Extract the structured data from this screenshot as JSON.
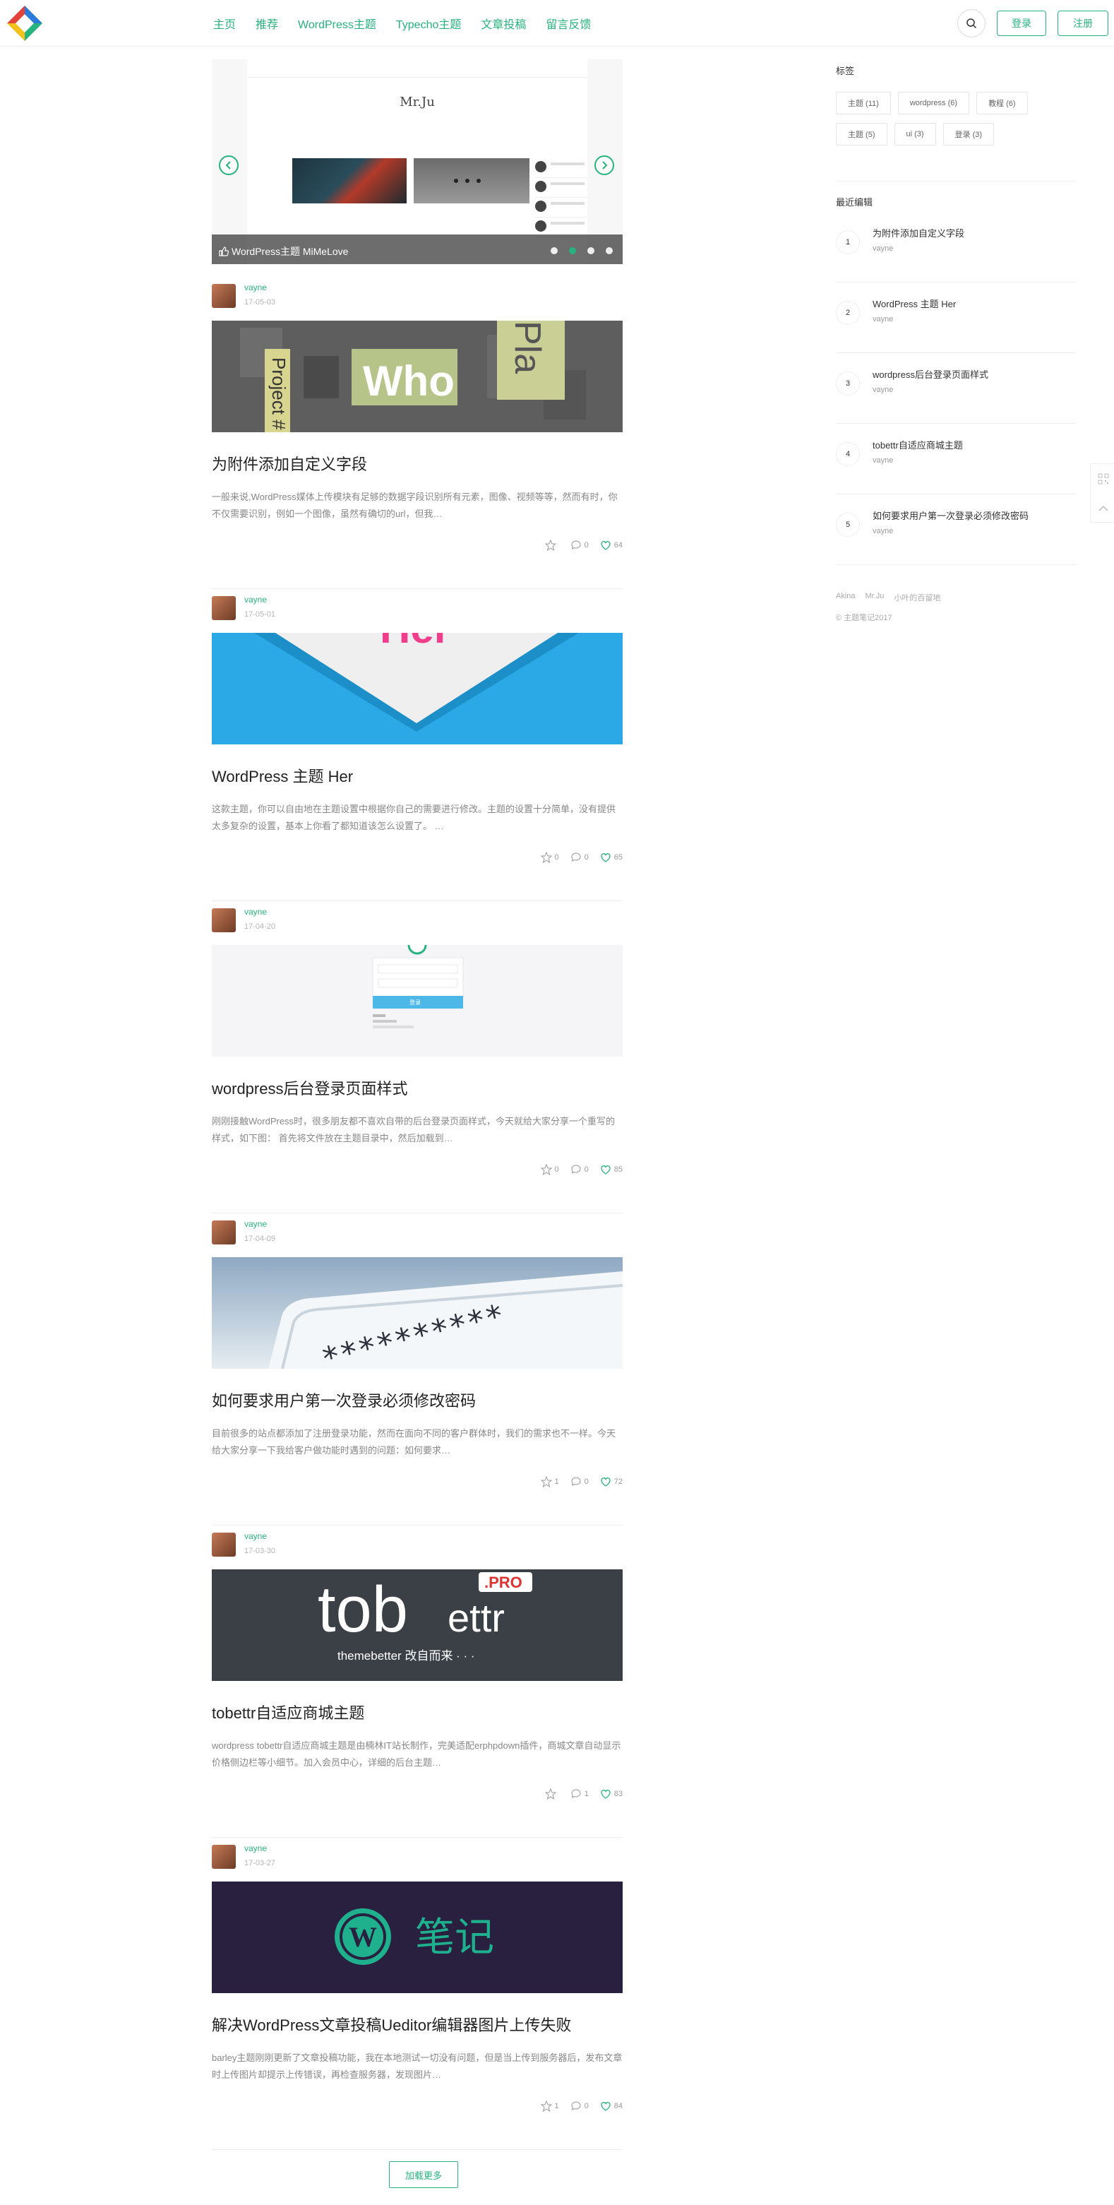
{
  "header": {
    "nav": [
      "主页",
      "推荐",
      "WordPress主题",
      "Typecho主题",
      "文章投稿",
      "留言反馈"
    ],
    "login_label": "登录",
    "register_label": "注册",
    "accent_color": "#27b37e"
  },
  "slider": {
    "caption": "WordPress主题 MiMeLove",
    "brand": "Mr.Ju",
    "dots": 4,
    "active_dot": 2
  },
  "posts": [
    {
      "author": "vayne",
      "date": "17-05-03",
      "title": "为附件添加自定义字段",
      "excerpt": "一般来说,WordPress媒体上传模块有足够的数据字段识别所有元素，图像、视频等等，然而有时，你不仅需要识别，例如一个图像，虽然有确切的url，但我…",
      "star": "",
      "comments": "0",
      "likes": "64",
      "thumb_text": "Who"
    },
    {
      "author": "vayne",
      "date": "17-05-01",
      "title": "WordPress 主题 Her",
      "excerpt": "这款主题，你可以自由地在主题设置中根据你自己的需要进行修改。主题的设置十分简单，没有提供太多复杂的设置，基本上你看了都知道该怎么设置了。 …",
      "star": "0",
      "comments": "0",
      "likes": "65",
      "thumb_text": "Her"
    },
    {
      "author": "vayne",
      "date": "17-04-20",
      "title": "wordpress后台登录页面样式",
      "excerpt": "刚刚接触WordPress时，很多朋友都不喜欢自带的后台登录页面样式，今天就给大家分享一个重写的样式，如下图： 首先将文件放在主题目录中，然后加载到…",
      "star": "0",
      "comments": "0",
      "likes": "85",
      "thumb_text": "登录"
    },
    {
      "author": "vayne",
      "date": "17-04-09",
      "title": "如何要求用户第一次登录必须修改密码",
      "excerpt": "目前很多的站点都添加了注册登录功能，然而在面向不同的客户群体时，我们的需求也不一样。今天给大家分享一下我给客户做功能时遇到的问题：如何要求…",
      "star": "1",
      "comments": "0",
      "likes": "72",
      "thumb_text": "**********"
    },
    {
      "author": "vayne",
      "date": "17-03-30",
      "title": "tobettr自适应商城主题",
      "excerpt": "wordpress tobettr自适应商城主题是由楠林IT站长制作，完美适配erphpdown插件，商城文章自动显示价格侧边栏等小细节。加入会员中心，详细的后台主题…",
      "star": "",
      "comments": "1",
      "likes": "83",
      "thumb_text": "tob",
      "thumb_text2": "ettr",
      "thumb_badge": ".PRO",
      "thumb_sub": "themebetter 改自而来 · · ·"
    },
    {
      "author": "vayne",
      "date": "17-03-27",
      "title": "解决WordPress文章投稿Ueditor编辑器图片上传失败",
      "excerpt": "barley主题刚刚更新了文章投稿功能，我在本地测试一切没有问题，但是当上传到服务器后，发布文章时上传图片却提示上传错误，再检查服务器，发现图片…",
      "star": "1",
      "comments": "0",
      "likes": "84",
      "thumb_text": "笔记"
    }
  ],
  "load_more_label": "加载更多",
  "sidebar": {
    "tags_title": "标签",
    "tags": [
      "主题 (11)",
      "wordpress (6)",
      "教程 (6)",
      "主题 (5)",
      "ui (3)",
      "登录 (3)"
    ],
    "recent_title": "最近编辑",
    "recent": [
      {
        "num": "1",
        "title": "为附件添加自定义字段",
        "author": "vayne"
      },
      {
        "num": "2",
        "title": "WordPress 主题 Her",
        "author": "vayne"
      },
      {
        "num": "3",
        "title": "wordpress后台登录页面样式",
        "author": "vayne"
      },
      {
        "num": "4",
        "title": "tobettr自适应商城主题",
        "author": "vayne"
      },
      {
        "num": "5",
        "title": "如何要求用户第一次登录必须修改密码",
        "author": "vayne"
      }
    ],
    "links": [
      "Akina",
      "Mr.Ju",
      "小叶的百留地"
    ],
    "copyright": "© 主题笔记2017"
  },
  "icons": {
    "search": "search-icon",
    "prev": "chevron-left-icon",
    "next": "chevron-right-icon",
    "star": "star-icon",
    "comment": "comment-icon",
    "heart": "heart-icon",
    "qrcode": "qrcode-icon",
    "top": "chevron-up-icon"
  }
}
